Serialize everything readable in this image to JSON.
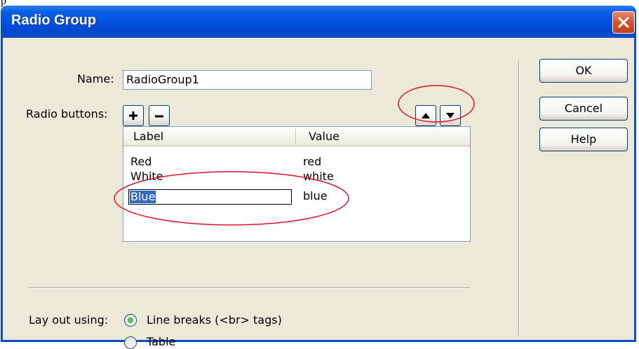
{
  "top_glyph": "p",
  "window": {
    "title": "Radio Group",
    "close_icon": "close-icon"
  },
  "form": {
    "name_label": "Name:",
    "name_value": "RadioGroup1",
    "radio_buttons_label": "Radio buttons:",
    "add_symbol": "+",
    "remove_symbol": "−"
  },
  "list": {
    "columns": [
      "Label",
      "Value"
    ],
    "rows": [
      {
        "label": "Red",
        "value": "red"
      },
      {
        "label": "White",
        "value": "white"
      },
      {
        "label": "Blue",
        "value": "blue"
      }
    ],
    "editing_row": 2
  },
  "layout": {
    "label": "Lay out using:",
    "options": [
      {
        "label": "Line breaks (<br> tags)",
        "selected": true
      },
      {
        "label": "Table",
        "selected": false
      }
    ]
  },
  "buttons": {
    "ok": "OK",
    "cancel": "Cancel",
    "help": "Help"
  },
  "colors": {
    "titlebar": "#0052dd",
    "face": "#ece9d8",
    "selection": "#316ac5",
    "annotation": "#e0102a",
    "close": "#d6532c"
  }
}
